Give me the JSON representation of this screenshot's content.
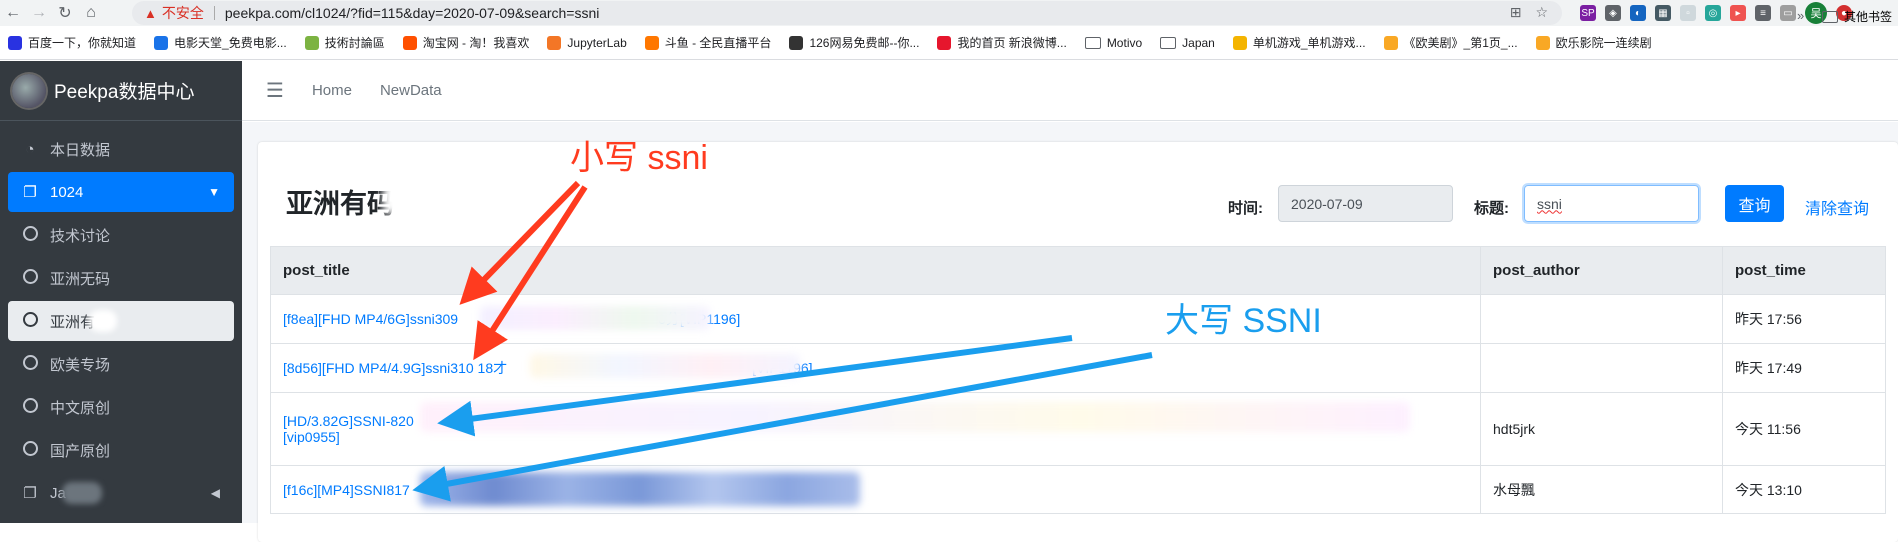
{
  "browser": {
    "url": "peekpa.com/cl1024/?fid=115&day=2020-07-09&search=ssni",
    "security_label": "不安全",
    "profile_initial": "吴",
    "bookmarks": [
      {
        "label": "百度一下，你就知道",
        "color": "#2932e1"
      },
      {
        "label": "电影天堂_免费电影...",
        "color": "#1a73e8"
      },
      {
        "label": "技術討論區",
        "color": "#7cb342"
      },
      {
        "label": "淘宝网 - 淘！我喜欢",
        "color": "#ff5000"
      },
      {
        "label": "JupyterLab",
        "color": "#f37626"
      },
      {
        "label": "斗鱼 - 全民直播平台",
        "color": "#ff7700"
      },
      {
        "label": "126网易免费邮--你...",
        "color": "#333333"
      },
      {
        "label": "我的首页 新浪微博...",
        "color": "#e6162d"
      },
      {
        "label": "Motivo",
        "folder": true
      },
      {
        "label": "Japan",
        "folder": true
      },
      {
        "label": "单机游戏_单机游戏...",
        "color": "#f4b400"
      },
      {
        "label": "《欧美剧》_第1页_...",
        "color": "#f9a825"
      },
      {
        "label": "欧乐影院一连续剧",
        "color": "#f9a825"
      }
    ],
    "bookmarks_more": "»",
    "other_bookmarks": "其他书签"
  },
  "sidebar": {
    "brand": "Peekpa数据中心",
    "items": [
      {
        "label": "本日数据",
        "icon": "dashboard-icon"
      },
      {
        "label": "1024",
        "icon": "copy-icon"
      },
      {
        "label": "技术讨论",
        "icon": "circle-icon"
      },
      {
        "label": "亚洲无码",
        "icon": "circle-icon"
      },
      {
        "label": "亚洲有",
        "icon": "circle-icon"
      },
      {
        "label": "欧美专场",
        "icon": "circle-icon"
      },
      {
        "label": "中文原创",
        "icon": "circle-icon"
      },
      {
        "label": "国产原创",
        "icon": "circle-icon"
      },
      {
        "label": "Ja",
        "icon": "copy-icon"
      }
    ]
  },
  "topnav": {
    "links": [
      "Home",
      "NewData"
    ]
  },
  "card": {
    "title": "亚洲有码",
    "time_label": "时间:",
    "time_value": "2020-07-09",
    "title_label": "标题:",
    "search_value": "ssni",
    "query_button": "查询",
    "clear_button": "清除查询"
  },
  "table": {
    "headers": [
      "post_title",
      "post_author",
      "post_time"
    ],
    "rows": [
      {
        "title_a": "[f8ea][FHD MP4/6G]ssni309",
        "title_b": "0分[VIP1196]",
        "author": "",
        "time": "昨天 17:56"
      },
      {
        "title_a": "[8d56][FHD MP4/4.9G]ssni310 18才",
        "title_b": "[VIP1196]",
        "author": "",
        "time": "昨天 17:49"
      },
      {
        "title_a": "[HD/3.82G]SSNI-820",
        "title_b": "[vip0955]",
        "author": "hdt5jrk",
        "time": "今天 11:56"
      },
      {
        "title_a": "[f16c][MP4]SSNI817",
        "title_b": "",
        "author": "水母飄",
        "time": "今天 13:10"
      }
    ]
  },
  "annotations": {
    "lowercase": "小写 ssni",
    "uppercase": "大写 SSNI",
    "red": "#ff3b1f",
    "blue": "#1a9eee"
  }
}
